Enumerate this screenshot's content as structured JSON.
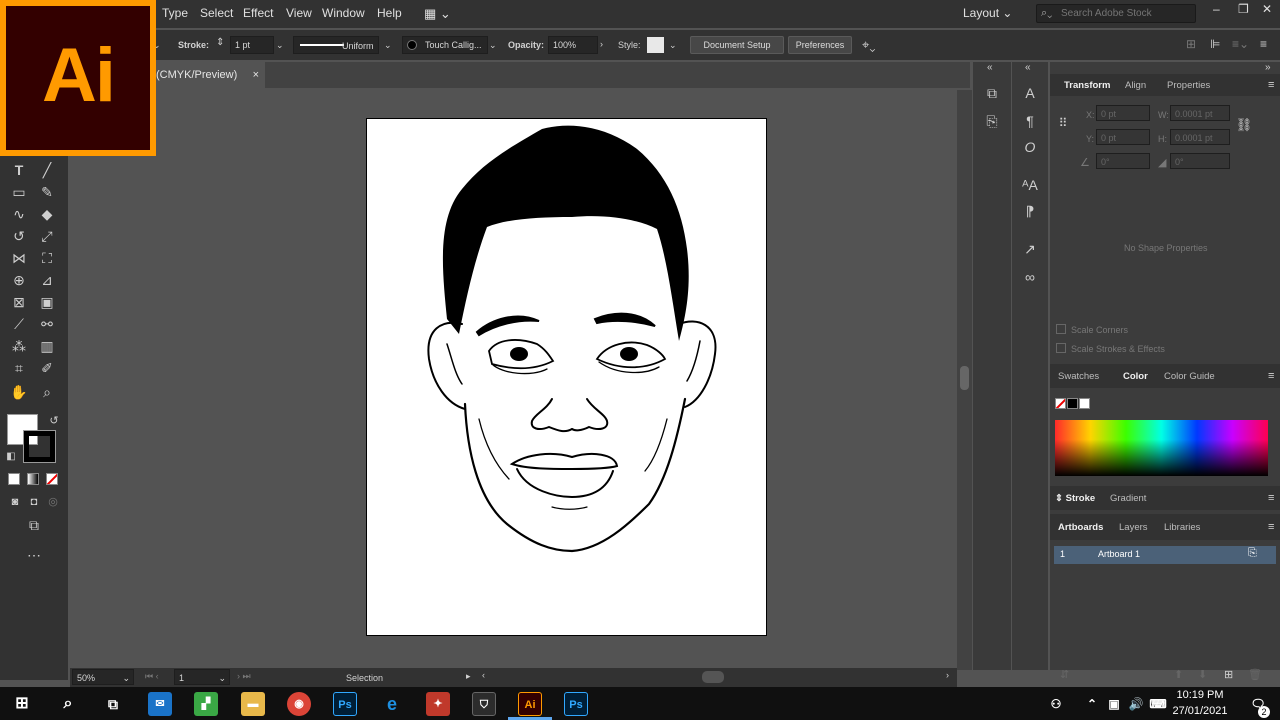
{
  "menu": {
    "type": "Type",
    "select": "Select",
    "effect": "Effect",
    "view": "View",
    "window": "Window",
    "help": "Help"
  },
  "workspace": "Layout",
  "search": {
    "placeholder": "Search Adobe Stock"
  },
  "logo": {
    "text": "Ai"
  },
  "control": {
    "stroke_label": "Stroke:",
    "stroke_value": "1 pt",
    "profile": "Uniform",
    "brush": "Touch Callig...",
    "opacity_label": "Opacity:",
    "opacity_value": "100%",
    "style_label": "Style:",
    "document_setup": "Document Setup",
    "preferences": "Preferences"
  },
  "doc_tab": {
    "title": "(CMYK/Preview)",
    "close": "×"
  },
  "status": {
    "zoom": "50%",
    "artboard_num": "1",
    "tool": "Selection"
  },
  "transform": {
    "tabs": [
      "Transform",
      "Align",
      "Properties"
    ],
    "x_label": "X:",
    "x": "0 pt",
    "y_label": "Y:",
    "y": "0 pt",
    "w_label": "W:",
    "w": "0.0001 pt",
    "h_label": "H:",
    "h": "0.0001 pt",
    "angle": "0°",
    "shear": "0°",
    "no_shape": "No Shape Properties",
    "scale_corners": "Scale Corners",
    "scale_strokes": "Scale Strokes & Effects"
  },
  "color_panel": {
    "tabs": [
      "Swatches",
      "Color",
      "Color Guide"
    ]
  },
  "stroke_panel": {
    "tabs": [
      "Stroke",
      "Gradient"
    ]
  },
  "artboards_panel": {
    "tabs": [
      "Artboards",
      "Layers",
      "Libraries"
    ],
    "rows": [
      {
        "num": "1",
        "name": "Artboard 1"
      }
    ]
  },
  "taskbar": {
    "time": "10:19 PM",
    "date": "27/01/2021",
    "notif": "2",
    "ps": "Ps",
    "ai": "Ai"
  }
}
